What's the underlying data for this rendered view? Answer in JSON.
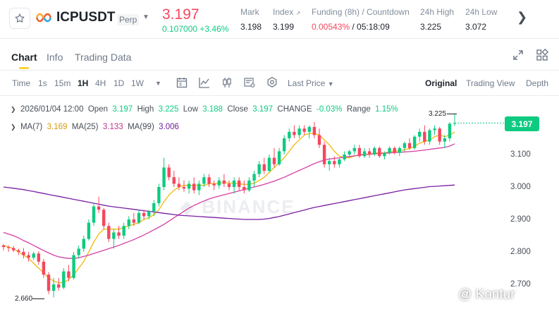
{
  "header": {
    "symbol": "ICPUSDT",
    "contract_type": "Perp",
    "last_price": "3.197",
    "price_change": "0.107000 +3.46%",
    "stats": [
      {
        "label": "Mark",
        "value": "3.198"
      },
      {
        "label": "Index",
        "value": "3.199"
      },
      {
        "label": "Funding (8h) / Countdown",
        "value_funding": "0.00543%",
        "value_countdown": " / 05:18:09"
      },
      {
        "label": "24h High",
        "value": "3.225"
      },
      {
        "label": "24h Low",
        "value": "3.072"
      }
    ],
    "colors": {
      "down": "#f6465d",
      "up": "#0ecb81",
      "accent": "#fcd535"
    }
  },
  "tabs": [
    "Chart",
    "Info",
    "Trading Data"
  ],
  "toolbar": {
    "time_label": "Time",
    "intervals": [
      "1s",
      "15m",
      "1H",
      "4H",
      "1D",
      "1W"
    ],
    "selected_interval": "1H",
    "price_type": "Last Price",
    "views": [
      "Original",
      "Trading View",
      "Depth"
    ],
    "selected_view": "Original"
  },
  "legend": {
    "date": "2026/01/04 12:00",
    "open_label": "Open",
    "open": "3.197",
    "high_label": "High",
    "high": "3.225",
    "low_label": "Low",
    "low": "3.188",
    "close_label": "Close",
    "close": "3.197",
    "change_label": "CHANGE",
    "change": "-0.03%",
    "range_label": "Range",
    "range": "1.15%",
    "ma7_label": "MA(7)",
    "ma7": "3.169",
    "ma25_label": "MA(25)",
    "ma25": "3.133",
    "ma99_label": "MA(99)",
    "ma99": "3.006"
  },
  "chart": {
    "current_price_tag": "3.197",
    "high_marker": "3.225",
    "low_marker": "2.660",
    "watermark": "BINANCE",
    "watermark_source": "@ Kontur"
  },
  "chart_data": {
    "type": "candlestick",
    "interval": "1H",
    "y_ticks": [
      "3.100",
      "3.000",
      "2.900",
      "2.800",
      "2.700"
    ],
    "ylim": [
      2.63,
      3.25
    ],
    "grid": false,
    "candles": [
      [
        2.82,
        2.825,
        2.805,
        2.815
      ],
      [
        2.815,
        2.82,
        2.8,
        2.812
      ],
      [
        2.812,
        2.818,
        2.8,
        2.805
      ],
      [
        2.805,
        2.81,
        2.79,
        2.8
      ],
      [
        2.8,
        2.812,
        2.78,
        2.79
      ],
      [
        2.79,
        2.8,
        2.77,
        2.782
      ],
      [
        2.782,
        2.8,
        2.775,
        2.795
      ],
      [
        2.795,
        2.802,
        2.76,
        2.77
      ],
      [
        2.77,
        2.778,
        2.72,
        2.73
      ],
      [
        2.73,
        2.738,
        2.67,
        2.68
      ],
      [
        2.68,
        2.72,
        2.66,
        2.7
      ],
      [
        2.7,
        2.72,
        2.68,
        2.69
      ],
      [
        2.69,
        2.75,
        2.685,
        2.74
      ],
      [
        2.74,
        2.76,
        2.71,
        2.72
      ],
      [
        2.72,
        2.8,
        2.715,
        2.79
      ],
      [
        2.79,
        2.82,
        2.78,
        2.81
      ],
      [
        2.81,
        2.85,
        2.8,
        2.84
      ],
      [
        2.84,
        2.9,
        2.835,
        2.89
      ],
      [
        2.89,
        2.95,
        2.88,
        2.94
      ],
      [
        2.94,
        2.97,
        2.92,
        2.93
      ],
      [
        2.93,
        2.935,
        2.87,
        2.88
      ],
      [
        2.88,
        2.89,
        2.83,
        2.84
      ],
      [
        2.84,
        2.87,
        2.81,
        2.86
      ],
      [
        2.86,
        2.88,
        2.84,
        2.85
      ],
      [
        2.85,
        2.89,
        2.84,
        2.88
      ],
      [
        2.88,
        2.91,
        2.87,
        2.9
      ],
      [
        2.9,
        2.92,
        2.88,
        2.89
      ],
      [
        2.89,
        2.93,
        2.885,
        2.92
      ],
      [
        2.92,
        2.93,
        2.9,
        2.91
      ],
      [
        2.91,
        2.93,
        2.9,
        2.925
      ],
      [
        2.925,
        2.96,
        2.91,
        2.95
      ],
      [
        2.95,
        3.01,
        2.94,
        3.0
      ],
      [
        3.0,
        3.09,
        2.99,
        3.06
      ],
      [
        3.06,
        3.07,
        3.02,
        3.03
      ],
      [
        3.03,
        3.05,
        3.0,
        3.01
      ],
      [
        3.01,
        3.03,
        2.99,
        3.0
      ],
      [
        3.0,
        3.02,
        2.985,
        2.995
      ],
      [
        2.995,
        3.02,
        2.98,
        3.01
      ],
      [
        3.01,
        3.03,
        2.98,
        2.99
      ],
      [
        2.99,
        3.02,
        2.975,
        3.01
      ],
      [
        3.01,
        3.04,
        3.0,
        3.03
      ],
      [
        3.03,
        3.04,
        3.0,
        3.01
      ],
      [
        3.01,
        3.02,
        2.99,
        3.005
      ],
      [
        3.005,
        3.03,
        2.995,
        3.02
      ],
      [
        3.02,
        3.04,
        3.0,
        3.01
      ],
      [
        3.01,
        3.02,
        2.99,
        3.0
      ],
      [
        3.0,
        3.03,
        2.98,
        3.02
      ],
      [
        3.02,
        3.03,
        2.99,
        3.0
      ],
      [
        3.0,
        3.02,
        2.98,
        2.99
      ],
      [
        2.99,
        3.03,
        2.985,
        3.02
      ],
      [
        3.02,
        3.05,
        3.0,
        3.04
      ],
      [
        3.04,
        3.08,
        3.03,
        3.07
      ],
      [
        3.07,
        3.09,
        3.04,
        3.05
      ],
      [
        3.05,
        3.1,
        3.045,
        3.09
      ],
      [
        3.09,
        3.12,
        3.06,
        3.07
      ],
      [
        3.07,
        3.12,
        3.065,
        3.11
      ],
      [
        3.11,
        3.16,
        3.1,
        3.15
      ],
      [
        3.15,
        3.18,
        3.14,
        3.17
      ],
      [
        3.17,
        3.19,
        3.15,
        3.16
      ],
      [
        3.16,
        3.19,
        3.15,
        3.18
      ],
      [
        3.18,
        3.19,
        3.16,
        3.17
      ],
      [
        3.17,
        3.19,
        3.15,
        3.185
      ],
      [
        3.185,
        3.2,
        3.15,
        3.16
      ],
      [
        3.16,
        3.18,
        3.12,
        3.13
      ],
      [
        3.13,
        3.14,
        3.06,
        3.07
      ],
      [
        3.07,
        3.09,
        3.05,
        3.08
      ],
      [
        3.08,
        3.095,
        3.06,
        3.07
      ],
      [
        3.07,
        3.09,
        3.06,
        3.085
      ],
      [
        3.085,
        3.11,
        3.08,
        3.1
      ],
      [
        3.1,
        3.115,
        3.09,
        3.11
      ],
      [
        3.11,
        3.13,
        3.1,
        3.12
      ],
      [
        3.12,
        3.13,
        3.09,
        3.095
      ],
      [
        3.095,
        3.12,
        3.09,
        3.11
      ],
      [
        3.11,
        3.12,
        3.09,
        3.1
      ],
      [
        3.1,
        3.125,
        3.095,
        3.12
      ],
      [
        3.12,
        3.125,
        3.09,
        3.095
      ],
      [
        3.095,
        3.11,
        3.085,
        3.105
      ],
      [
        3.105,
        3.125,
        3.1,
        3.12
      ],
      [
        3.12,
        3.125,
        3.1,
        3.105
      ],
      [
        3.105,
        3.125,
        3.095,
        3.12
      ],
      [
        3.12,
        3.14,
        3.11,
        3.135
      ],
      [
        3.135,
        3.15,
        3.115,
        3.12
      ],
      [
        3.12,
        3.16,
        3.115,
        3.155
      ],
      [
        3.155,
        3.18,
        3.14,
        3.17
      ],
      [
        3.17,
        3.19,
        3.13,
        3.14
      ],
      [
        3.14,
        3.18,
        3.13,
        3.175
      ],
      [
        3.175,
        3.19,
        3.16,
        3.18
      ],
      [
        3.18,
        3.185,
        3.13,
        3.14
      ],
      [
        3.14,
        3.16,
        3.12,
        3.15
      ],
      [
        3.15,
        3.2,
        3.14,
        3.195
      ],
      [
        3.195,
        3.225,
        3.188,
        3.197
      ]
    ],
    "ma_series": [
      {
        "name": "MA(7)",
        "color": "#f0b90b",
        "values": [
          2.82,
          2.815,
          2.81,
          2.8,
          2.79,
          2.78,
          2.765,
          2.75,
          2.735,
          2.72,
          2.71,
          2.705,
          2.705,
          2.715,
          2.73,
          2.75,
          2.77,
          2.8,
          2.83,
          2.855,
          2.87,
          2.87,
          2.87,
          2.87,
          2.875,
          2.88,
          2.885,
          2.89,
          2.9,
          2.905,
          2.915,
          2.93,
          2.955,
          2.975,
          2.99,
          3.0,
          3.005,
          3.005,
          3.005,
          3.005,
          3.005,
          3.01,
          3.01,
          3.012,
          3.014,
          3.012,
          3.012,
          3.01,
          3.008,
          3.008,
          3.012,
          3.02,
          3.03,
          3.045,
          3.06,
          3.075,
          3.09,
          3.11,
          3.13,
          3.145,
          3.16,
          3.165,
          3.165,
          3.16,
          3.145,
          3.13,
          3.11,
          3.095,
          3.09,
          3.09,
          3.095,
          3.1,
          3.1,
          3.1,
          3.105,
          3.105,
          3.105,
          3.108,
          3.11,
          3.112,
          3.115,
          3.118,
          3.125,
          3.135,
          3.14,
          3.145,
          3.155,
          3.16,
          3.155,
          3.16,
          3.169
        ]
      },
      {
        "name": "MA(25)",
        "color": "#d63fa7",
        "values": [
          2.86,
          2.855,
          2.85,
          2.843,
          2.835,
          2.828,
          2.82,
          2.812,
          2.804,
          2.797,
          2.79,
          2.785,
          2.782,
          2.78,
          2.78,
          2.782,
          2.786,
          2.79,
          2.795,
          2.8,
          2.805,
          2.81,
          2.815,
          2.82,
          2.826,
          2.832,
          2.838,
          2.845,
          2.852,
          2.86,
          2.868,
          2.876,
          2.885,
          2.895,
          2.905,
          2.915,
          2.925,
          2.935,
          2.943,
          2.95,
          2.957,
          2.963,
          2.968,
          2.972,
          2.976,
          2.98,
          2.984,
          2.988,
          2.992,
          2.996,
          3.0,
          3.004,
          3.008,
          3.013,
          3.018,
          3.024,
          3.03,
          3.037,
          3.044,
          3.051,
          3.058,
          3.065,
          3.072,
          3.078,
          3.083,
          3.086,
          3.088,
          3.09,
          3.092,
          3.094,
          3.096,
          3.098,
          3.1,
          3.101,
          3.102,
          3.103,
          3.104,
          3.105,
          3.106,
          3.107,
          3.108,
          3.109,
          3.11,
          3.112,
          3.114,
          3.116,
          3.118,
          3.12,
          3.122,
          3.126,
          3.133
        ]
      },
      {
        "name": "MA(99)",
        "color": "#7a1fa2",
        "values": [
          3.0,
          2.998,
          2.996,
          2.994,
          2.992,
          2.989,
          2.986,
          2.983,
          2.98,
          2.977,
          2.974,
          2.971,
          2.968,
          2.965,
          2.962,
          2.959,
          2.956,
          2.953,
          2.95,
          2.947,
          2.944,
          2.941,
          2.939,
          2.937,
          2.935,
          2.933,
          2.931,
          2.929,
          2.927,
          2.925,
          2.923,
          2.921,
          2.919,
          2.917,
          2.915,
          2.913,
          2.912,
          2.911,
          2.91,
          2.909,
          2.908,
          2.907,
          2.906,
          2.905,
          2.904,
          2.903,
          2.902,
          2.901,
          2.9,
          2.9,
          2.9,
          2.9,
          2.901,
          2.903,
          2.906,
          2.909,
          2.913,
          2.917,
          2.921,
          2.925,
          2.929,
          2.933,
          2.937,
          2.94,
          2.943,
          2.946,
          2.949,
          2.952,
          2.955,
          2.958,
          2.961,
          2.964,
          2.967,
          2.97,
          2.973,
          2.976,
          2.979,
          2.982,
          2.985,
          2.988,
          2.991,
          2.993,
          2.995,
          2.997,
          2.999,
          3.001,
          3.002,
          3.003,
          3.004,
          3.005,
          3.006
        ]
      }
    ]
  }
}
